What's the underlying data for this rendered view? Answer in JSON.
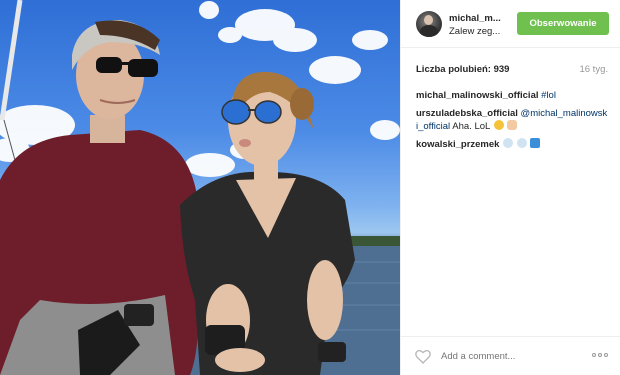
{
  "post": {
    "username": "michal_m...",
    "location": "Zalew zeg...",
    "follow_label": "Obserwowanie",
    "likes": "Liczba polubień: 939",
    "age": "16 tyg.",
    "add_comment_placeholder": "Add a comment...",
    "icons": {
      "like": "heart-icon",
      "more": "ellipsis-icon",
      "avatar": "user-avatar"
    },
    "colors": {
      "follow": "#70c050",
      "link": "#003569",
      "muted": "#999999"
    }
  },
  "comments": [
    {
      "user": "michal_malinowski_official",
      "text": "#lol",
      "text_is_link": true
    },
    {
      "user": "urszuladebska_official",
      "mention": "@michal_malinowsk i_official",
      "text": "Aha. LoL",
      "emojis": [
        "laughing-crying-emoji",
        "peace-hand-emoji"
      ]
    },
    {
      "user": "kowalski_przemek",
      "emojis": [
        "dash-emoji",
        "dash-emoji",
        "boat-emoji"
      ]
    }
  ],
  "photo": {
    "description_icon": "selfie-photo"
  }
}
